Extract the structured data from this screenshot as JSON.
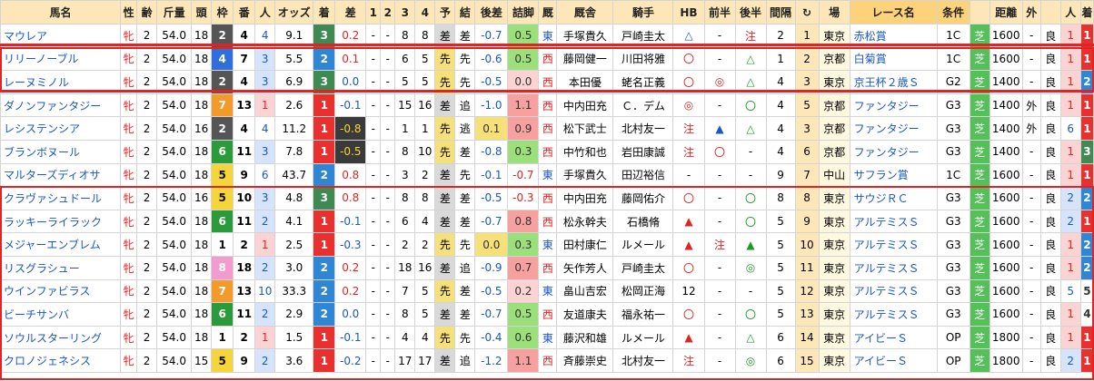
{
  "headers": [
    "馬名",
    "性",
    "齢",
    "斤量",
    "頭",
    "枠",
    "番",
    "人",
    "オッズ",
    "着",
    "差",
    "1",
    "2",
    "3",
    "4",
    "予",
    "結",
    "後差",
    "詰脚",
    "厩",
    "厩舎",
    "騎手",
    "HB",
    "前半",
    "後半",
    "間隔",
    "↻",
    "場",
    "レース名",
    "条件",
    "",
    "距離",
    "外",
    "",
    "人",
    "着"
  ],
  "rows": [
    {
      "name": "マウレア",
      "sex": "牝",
      "age": "2",
      "kin": "54.0",
      "tou": "18",
      "waku": "2",
      "ban": "4",
      "nin": "4",
      "odds": "9.1",
      "chaku": "3",
      "sa": "0.2",
      "c1": "-",
      "c2": "-",
      "c3": "8",
      "c4": "8",
      "yo": "差",
      "ketsu": "差",
      "atosa": "-0.7",
      "tsume": "0.5",
      "kyu": "東",
      "kyusha": "手塚貴久",
      "kishu": "戸崎圭太",
      "hb": "△",
      "zen": "-",
      "kou": "注",
      "kankaku": "2",
      "rot": "1",
      "ba": "東京",
      "race": "赤松賞",
      "cond": "1C",
      "turf": "芝",
      "dist": "1600",
      "soto": "-",
      "baba": "良",
      "rn": "1",
      "rc": "1"
    },
    {
      "name": "リリーノーブル",
      "sex": "牝",
      "age": "2",
      "kin": "54.0",
      "tou": "18",
      "waku": "4",
      "ban": "7",
      "nin": "3",
      "odds": "5.5",
      "chaku": "2",
      "sa": "0.1",
      "c1": "-",
      "c2": "-",
      "c3": "6",
      "c4": "5",
      "yo": "先",
      "ketsu": "先",
      "atosa": "-0.6",
      "tsume": "0.5",
      "kyu": "西",
      "kyusha": "藤岡健一",
      "kishu": "川田将雅",
      "hb": "〇",
      "zen": "-",
      "kou": "△",
      "kankaku": "1",
      "rot": "2",
      "ba": "京都",
      "race": "白菊賞",
      "cond": "1C",
      "turf": "芝",
      "dist": "1600",
      "soto": "-",
      "baba": "良",
      "rn": "1",
      "rc": "1"
    },
    {
      "name": "レーヌミノル",
      "sex": "牝",
      "age": "2",
      "kin": "54.0",
      "tou": "18",
      "waku": "2",
      "ban": "4",
      "nin": "3",
      "odds": "6.9",
      "chaku": "3",
      "sa": "0.0",
      "c1": "-",
      "c2": "-",
      "c3": "5",
      "c4": "5",
      "yo": "先",
      "ketsu": "先",
      "atosa": "-0.5",
      "tsume": "0.0",
      "kyu": "西",
      "kyusha": "本田優",
      "kishu": "蛯名正義",
      "hb": "〇",
      "zen": "◎",
      "kou": "△",
      "kankaku": "4",
      "rot": "3",
      "ba": "東京",
      "race": "京王杯２歳Ｓ",
      "cond": "G2",
      "turf": "芝",
      "dist": "1400",
      "soto": "-",
      "baba": "良",
      "rn": "1",
      "rc": "2"
    },
    {
      "name": "ダノンファンタジー",
      "sex": "牝",
      "age": "2",
      "kin": "54.0",
      "tou": "18",
      "waku": "7",
      "ban": "13",
      "nin": "1",
      "odds": "2.6",
      "chaku": "1",
      "sa": "-0.1",
      "c1": "-",
      "c2": "-",
      "c3": "15",
      "c4": "16",
      "yo": "差",
      "ketsu": "追",
      "atosa": "-1.0",
      "tsume": "1.1",
      "kyu": "西",
      "kyusha": "中内田充",
      "kishu": "Ｃ．デム",
      "hb": "◎",
      "zen": "-",
      "kou": "〇",
      "kankaku": "4",
      "rot": "5",
      "ba": "京都",
      "race": "ファンタジー",
      "cond": "G3",
      "turf": "芝",
      "dist": "1400",
      "soto": "外",
      "baba": "良",
      "rn": "1",
      "rc": "1"
    },
    {
      "name": "レシステンシア",
      "sex": "牝",
      "age": "2",
      "kin": "54.0",
      "tou": "16",
      "waku": "2",
      "ban": "4",
      "nin": "4",
      "odds": "11.2",
      "chaku": "1",
      "sa": "-0.8",
      "c1": "-",
      "c2": "-",
      "c3": "1",
      "c4": "1",
      "yo": "先",
      "ketsu": "逃",
      "atosa": "0.1",
      "tsume": "0.9",
      "kyu": "西",
      "kyusha": "松下武士",
      "kishu": "北村友一",
      "hb": "注",
      "zen": "▲",
      "kou": "△",
      "kankaku": "4",
      "rot": "3",
      "ba": "京都",
      "race": "ファンタジー",
      "cond": "G3",
      "turf": "芝",
      "dist": "1400",
      "soto": "外",
      "baba": "良",
      "rn": "6",
      "rc": "1"
    },
    {
      "name": "ブランボヌール",
      "sex": "牝",
      "age": "2",
      "kin": "54.0",
      "tou": "18",
      "waku": "6",
      "ban": "11",
      "nin": "3",
      "odds": "7.8",
      "chaku": "1",
      "sa": "-0.5",
      "c1": "-",
      "c2": "-",
      "c3": "8",
      "c4": "10",
      "yo": "先",
      "ketsu": "差",
      "atosa": "-0.8",
      "tsume": "0.3",
      "kyu": "西",
      "kyusha": "中竹和也",
      "kishu": "岩田康誠",
      "hb": "注",
      "zen": "〇",
      "kou": "-",
      "kankaku": "4",
      "rot": "6",
      "ba": "京都",
      "race": "ファンタジー",
      "cond": "G3",
      "turf": "芝",
      "dist": "1400",
      "soto": "-",
      "baba": "良",
      "rn": "1",
      "rc": "3"
    },
    {
      "name": "マルターズディオサ",
      "sex": "牝",
      "age": "2",
      "kin": "54.0",
      "tou": "18",
      "waku": "5",
      "ban": "9",
      "nin": "6",
      "odds": "43.7",
      "chaku": "2",
      "sa": "0.8",
      "c1": "-",
      "c2": "-",
      "c3": "3",
      "c4": "2",
      "yo": "差",
      "ketsu": "先",
      "atosa": "-0.1",
      "tsume": "-0.7",
      "kyu": "東",
      "kyusha": "手塚貴久",
      "kishu": "田辺裕信",
      "hb": "-",
      "zen": "-",
      "kou": "-",
      "kankaku": "9",
      "rot": "7",
      "ba": "中山",
      "race": "サフラン賞",
      "cond": "1C",
      "turf": "芝",
      "dist": "1600",
      "soto": "-",
      "baba": "良",
      "rn": "1",
      "rc": "1"
    },
    {
      "name": "クラヴァシュドール",
      "sex": "牝",
      "age": "2",
      "kin": "54.0",
      "tou": "16",
      "waku": "5",
      "ban": "10",
      "nin": "3",
      "odds": "4.8",
      "chaku": "3",
      "sa": "0.8",
      "c1": "-",
      "c2": "-",
      "c3": "8",
      "c4": "8",
      "yo": "差",
      "ketsu": "差",
      "atosa": "-0.5",
      "tsume": "-0.3",
      "kyu": "西",
      "kyusha": "中内田充",
      "kishu": "藤岡佑介",
      "hb": "〇",
      "zen": "-",
      "kou": "〇",
      "kankaku": "8",
      "rot": "8",
      "ba": "東京",
      "race": "サウジＲＣ",
      "cond": "G3",
      "turf": "芝",
      "dist": "1600",
      "soto": "-",
      "baba": "良",
      "rn": "2",
      "rc": "2"
    },
    {
      "name": "ラッキーライラック",
      "sex": "牝",
      "age": "2",
      "kin": "54.0",
      "tou": "18",
      "waku": "6",
      "ban": "11",
      "nin": "2",
      "odds": "4.1",
      "chaku": "1",
      "sa": "-0.1",
      "c1": "-",
      "c2": "-",
      "c3": "6",
      "c4": "4",
      "yo": "差",
      "ketsu": "差",
      "atosa": "-0.7",
      "tsume": "0.8",
      "kyu": "西",
      "kyusha": "松永幹夫",
      "kishu": "石橋脩",
      "hb": "▲",
      "zen": "-",
      "kou": "〇",
      "kankaku": "5",
      "rot": "9",
      "ba": "東京",
      "race": "アルテミスＳ",
      "cond": "G3",
      "turf": "芝",
      "dist": "1600",
      "soto": "-",
      "baba": "良",
      "rn": "2",
      "rc": "1"
    },
    {
      "name": "メジャーエンブレム",
      "sex": "牝",
      "age": "2",
      "kin": "54.0",
      "tou": "18",
      "waku": "1",
      "ban": "2",
      "nin": "1",
      "odds": "2.5",
      "chaku": "1",
      "sa": "-0.3",
      "c1": "-",
      "c2": "-",
      "c3": "2",
      "c4": "2",
      "yo": "先",
      "ketsu": "先",
      "atosa": "0.0",
      "tsume": "0.3",
      "kyu": "東",
      "kyusha": "田村康仁",
      "kishu": "ルメール",
      "hb": "▲",
      "zen": "注",
      "kou": "▲",
      "kankaku": "5",
      "rot": "10",
      "ba": "東京",
      "race": "アルテミスＳ",
      "cond": "G3",
      "turf": "芝",
      "dist": "1600",
      "soto": "-",
      "baba": "良",
      "rn": "1",
      "rc": "2"
    },
    {
      "name": "リスグラシュー",
      "sex": "牝",
      "age": "2",
      "kin": "54.0",
      "tou": "18",
      "waku": "8",
      "ban": "18",
      "nin": "2",
      "odds": "3.0",
      "chaku": "2",
      "sa": "0.2",
      "c1": "-",
      "c2": "-",
      "c3": "18",
      "c4": "16",
      "yo": "差",
      "ketsu": "追",
      "atosa": "-0.9",
      "tsume": "0.7",
      "kyu": "西",
      "kyusha": "矢作芳人",
      "kishu": "戸崎圭太",
      "hb": "〇",
      "zen": "-",
      "kou": "◎",
      "kankaku": "5",
      "rot": "11",
      "ba": "東京",
      "race": "アルテミスＳ",
      "cond": "G3",
      "turf": "芝",
      "dist": "1600",
      "soto": "-",
      "baba": "良",
      "rn": "1",
      "rc": "2"
    },
    {
      "name": "ウインファビラス",
      "sex": "牝",
      "age": "2",
      "kin": "54.0",
      "tou": "18",
      "waku": "7",
      "ban": "13",
      "nin": "10",
      "odds": "33.3",
      "chaku": "2",
      "sa": "0.2",
      "c1": "-",
      "c2": "-",
      "c3": "7",
      "c4": "5",
      "yo": "先",
      "ketsu": "差",
      "atosa": "-0.5",
      "tsume": "0.2",
      "kyu": "東",
      "kyusha": "畠山吉宏",
      "kishu": "松岡正海",
      "hb": "12",
      "zen": "-",
      "kou": "-",
      "kankaku": "5",
      "rot": "12",
      "ba": "東京",
      "race": "アルテミスＳ",
      "cond": "G3",
      "turf": "芝",
      "dist": "1600",
      "soto": "-",
      "baba": "良",
      "rn": "5",
      "rc": "5"
    },
    {
      "name": "ビーチサンバ",
      "sex": "牝",
      "age": "2",
      "kin": "54.0",
      "tou": "18",
      "waku": "6",
      "ban": "11",
      "nin": "2",
      "odds": "2.9",
      "chaku": "2",
      "sa": "0.0",
      "c1": "-",
      "c2": "-",
      "c3": "8",
      "c4": "5",
      "yo": "差",
      "ketsu": "差",
      "atosa": "-0.7",
      "tsume": "0.5",
      "kyu": "西",
      "kyusha": "友道康夫",
      "kishu": "福永祐一",
      "hb": "〇",
      "zen": "-",
      "kou": "〇",
      "kankaku": "5",
      "rot": "13",
      "ba": "東京",
      "race": "アルテミスＳ",
      "cond": "G3",
      "turf": "芝",
      "dist": "1600",
      "soto": "-",
      "baba": "良",
      "rn": "1",
      "rc": "4"
    },
    {
      "name": "ソウルスターリング",
      "sex": "牝",
      "age": "2",
      "kin": "54.0",
      "tou": "18",
      "waku": "1",
      "ban": "2",
      "nin": "1",
      "odds": "1.5",
      "chaku": "1",
      "sa": "-0.1",
      "c1": "-",
      "c2": "-",
      "c3": "4",
      "c4": "4",
      "yo": "先",
      "ketsu": "先",
      "atosa": "-0.4",
      "tsume": "0.6",
      "kyu": "東",
      "kyusha": "藤沢和雄",
      "kishu": "ルメール",
      "hb": "▲",
      "zen": "-",
      "kou": "△",
      "kankaku": "6",
      "rot": "14",
      "ba": "東京",
      "race": "アイビーＳ",
      "cond": "OP",
      "turf": "芝",
      "dist": "1800",
      "soto": "-",
      "baba": "良",
      "rn": "1",
      "rc": "1"
    },
    {
      "name": "クロノジェネシス",
      "sex": "牝",
      "age": "2",
      "kin": "54.0",
      "tou": "15",
      "waku": "5",
      "ban": "9",
      "nin": "2",
      "odds": "3.6",
      "chaku": "1",
      "sa": "-0.2",
      "c1": "-",
      "c2": "-",
      "c3": "17",
      "c4": "17",
      "yo": "差",
      "ketsu": "追",
      "atosa": "-1.2",
      "tsume": "1.1",
      "kyu": "西",
      "kyusha": "斉藤崇史",
      "kishu": "北村友一",
      "hb": "注",
      "zen": "-",
      "kou": "◎",
      "kankaku": "6",
      "rot": "15",
      "ba": "東京",
      "race": "アイビーＳ",
      "cond": "OP",
      "turf": "芝",
      "dist": "1800",
      "soto": "-",
      "baba": "良",
      "rn": "2",
      "rc": "1"
    }
  ],
  "colors": {
    "waku": {
      "1": "#ffffff",
      "2": "#555555",
      "3": "#e8302e",
      "4": "#2e6fdc",
      "5": "#f6d53b",
      "6": "#2a9a3a",
      "7": "#f49a2a",
      "8": "#f29bd0"
    },
    "chaku": {
      "1": "#e8302e",
      "2": "#2e86d4",
      "3": "#3f8a52"
    },
    "yo": {
      "差": "#d9d9d9",
      "先": "#f6e07a"
    },
    "turf": "#55c05a"
  }
}
